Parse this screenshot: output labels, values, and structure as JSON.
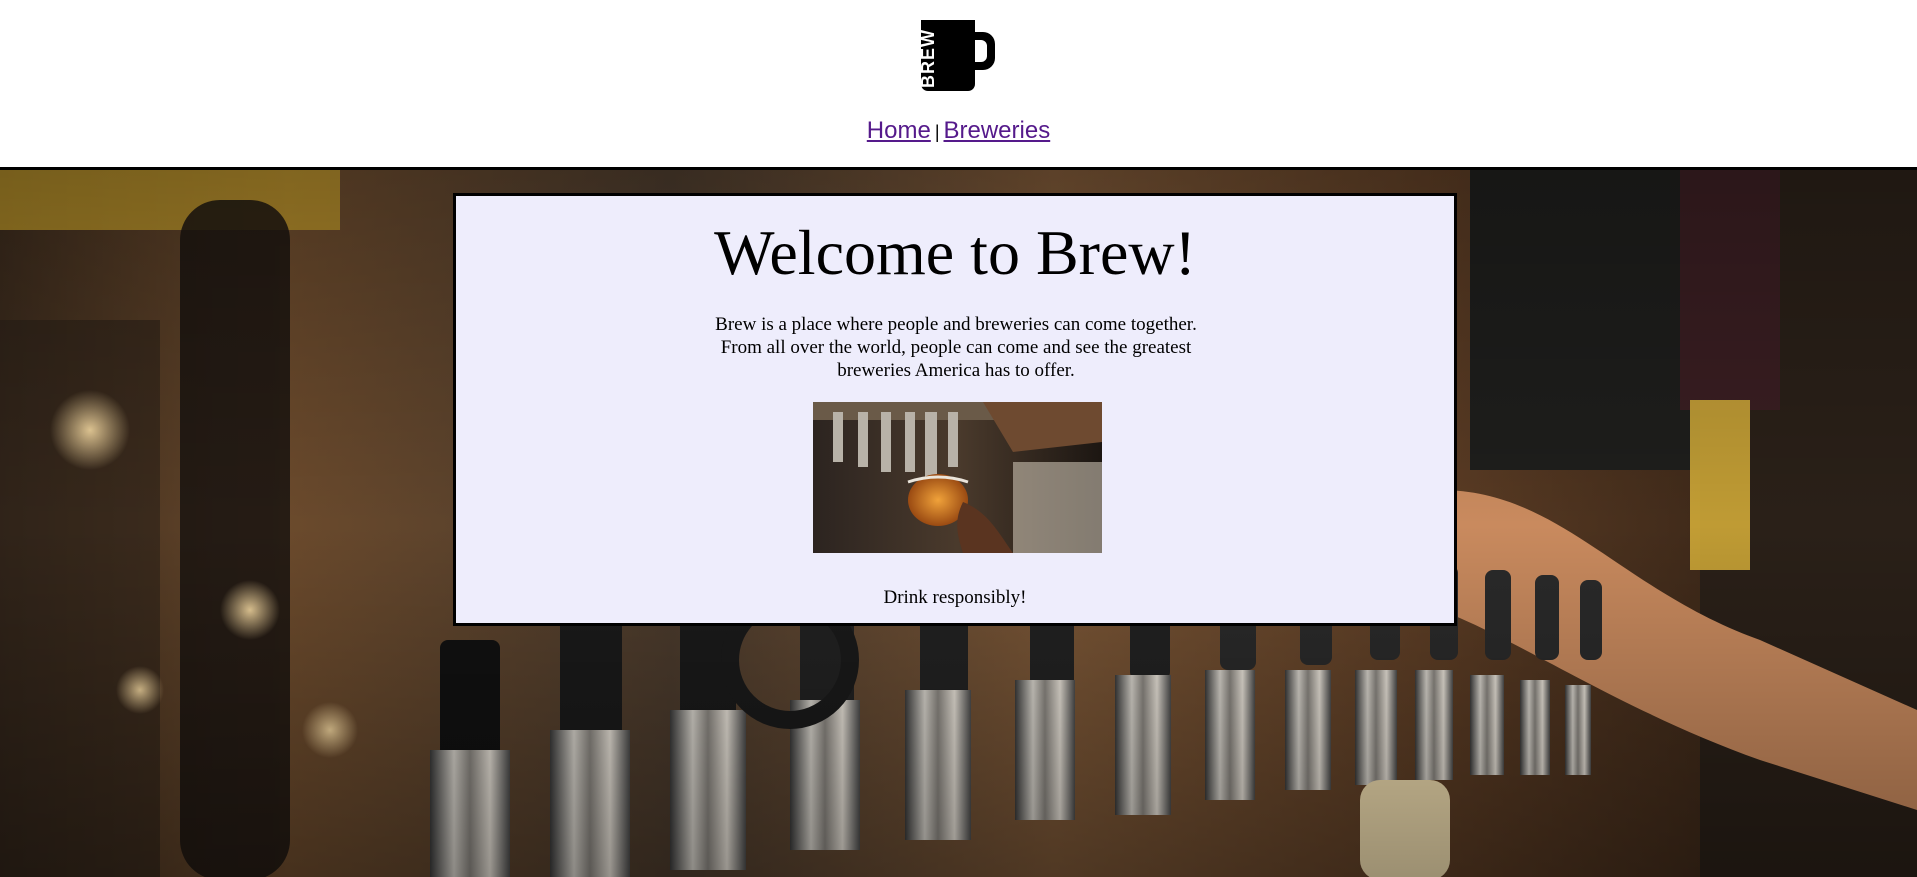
{
  "header": {
    "logo_text": "BREW",
    "nav": {
      "home_label": "Home",
      "separator": "|",
      "breweries_label": "Breweries"
    }
  },
  "main": {
    "title": "Welcome to Brew!",
    "intro": "Brew is a place where people and breweries can come together. From all over the world, people can come and see the greatest breweries America has to offer.",
    "outro": "Drink responsibly!"
  },
  "colors": {
    "link": "#551a8b",
    "card_background": "#eeedfc",
    "border": "#000000"
  }
}
